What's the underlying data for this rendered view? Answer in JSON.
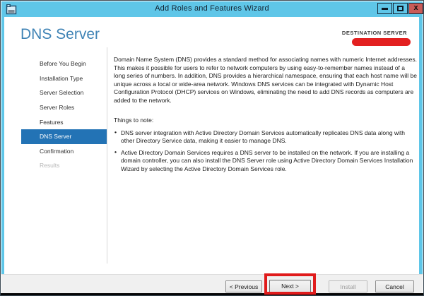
{
  "window": {
    "title": "Add Roles and Features Wizard",
    "close_glyph": "x"
  },
  "header": {
    "title": "DNS Server",
    "destination_label": "DESTINATION SERVER"
  },
  "sidebar": {
    "items": [
      {
        "label": "Before You Begin",
        "state": "normal"
      },
      {
        "label": "Installation Type",
        "state": "normal"
      },
      {
        "label": "Server Selection",
        "state": "normal"
      },
      {
        "label": "Server Roles",
        "state": "normal"
      },
      {
        "label": "Features",
        "state": "normal"
      },
      {
        "label": "DNS Server",
        "state": "selected"
      },
      {
        "label": "Confirmation",
        "state": "normal"
      },
      {
        "label": "Results",
        "state": "disabled"
      }
    ]
  },
  "content": {
    "intro": "Domain Name System (DNS) provides a standard method for associating names with numeric Internet addresses. This makes it possible for users to refer to network computers by using easy-to-remember names instead of a long series of numbers. In addition, DNS provides a hierarchical namespace, ensuring that each host name will be unique across a local or wide-area network. Windows DNS services can be integrated with Dynamic Host Configuration Protocol (DHCP) services on Windows, eliminating the need to add DNS records as computers are added to the network.",
    "note_heading": "Things to note:",
    "notes": [
      "DNS server integration with Active Directory Domain Services automatically replicates DNS data along with other Directory Service data, making it easier to manage DNS.",
      "Active Directory Domain Services requires a DNS server to be installed on the network. If you are installing a domain controller, you can also install the DNS Server role using Active Directory Domain Services Installation Wizard by selecting the Active Directory Domain Services role."
    ]
  },
  "footer": {
    "previous_label": "< Previous",
    "next_label": "Next >",
    "install_label": "Install",
    "cancel_label": "Cancel"
  },
  "annotations": {
    "highlight_color": "#e01b1b",
    "titlebar_color": "#5fc6e8",
    "nav_selected_color": "#2373b5",
    "heading_color": "#3f83b5"
  }
}
